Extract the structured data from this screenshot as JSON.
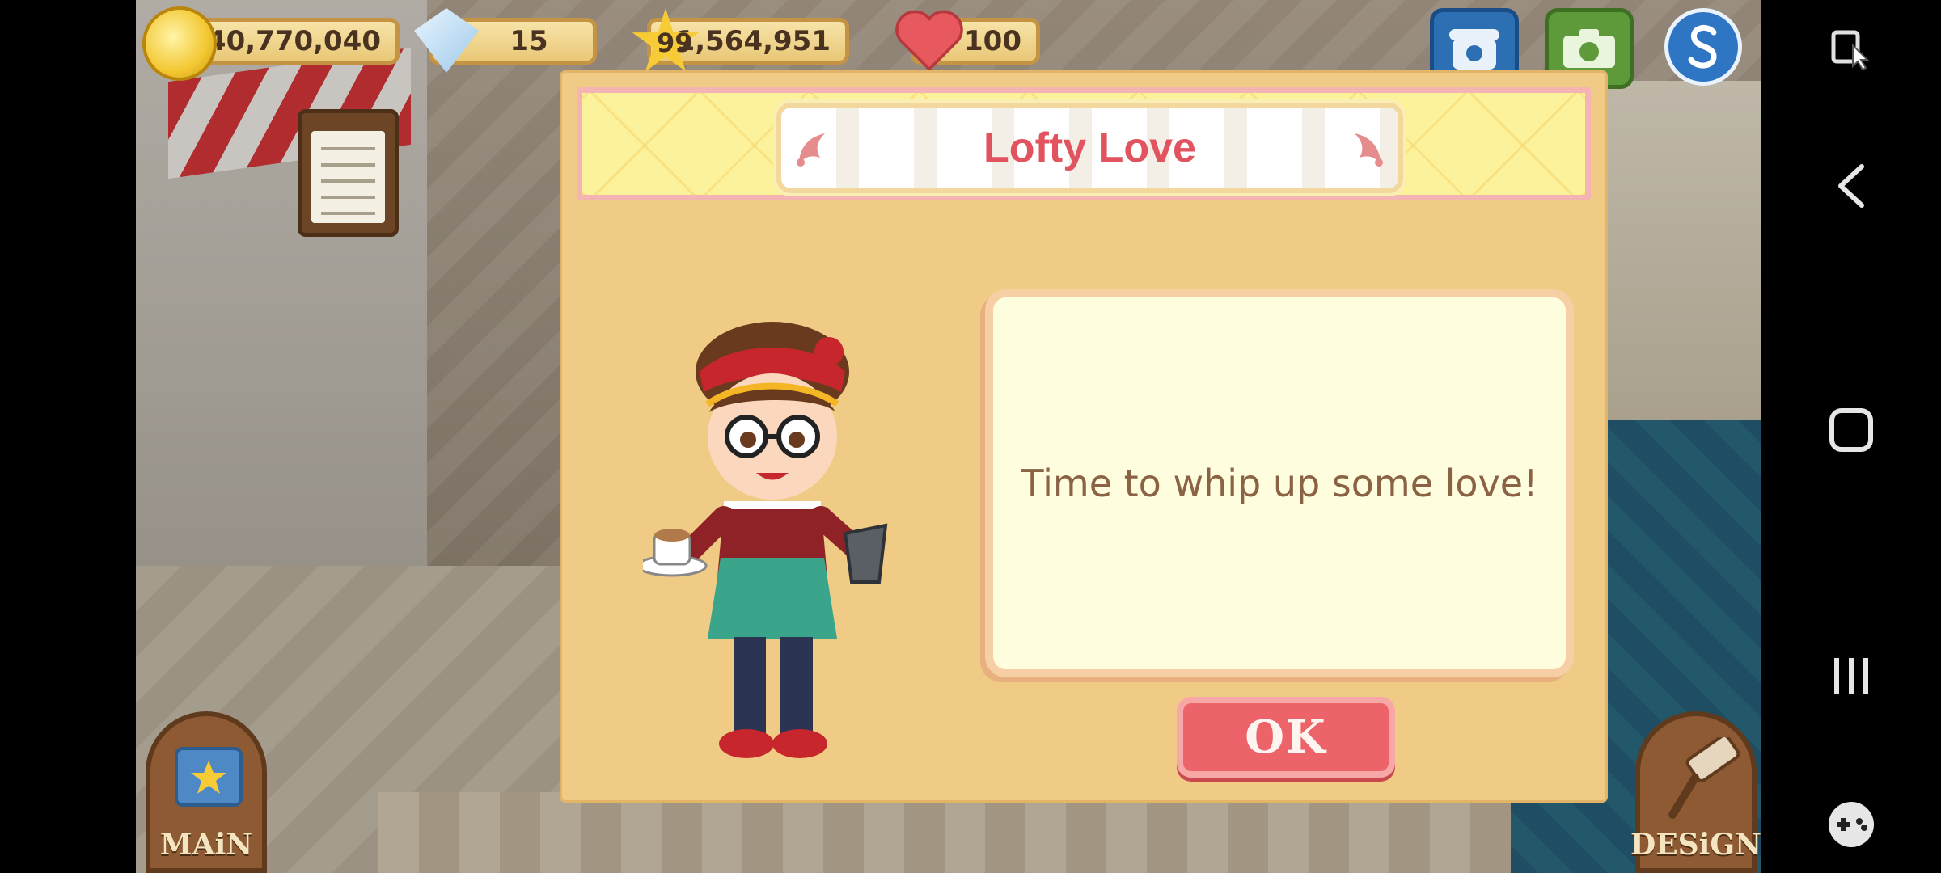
{
  "hud": {
    "coins": "40,770,040",
    "gems": "15",
    "level": "99",
    "xp": "1,564,951",
    "hearts": "100"
  },
  "icons": {
    "coin": "coin-icon",
    "gem": "gem-icon",
    "star": "star-icon",
    "heart": "heart-icon",
    "phone": "phone-icon",
    "camera": "camera-icon",
    "social": "social-icon",
    "clipboard": "clipboard-icon",
    "recipe_book": "recipe-book-icon",
    "paint_roller": "paint-roller-icon"
  },
  "bottom_buttons": {
    "main_label": "MAiN",
    "design_label": "DESiGN"
  },
  "dialog": {
    "title": "Lofty Love",
    "message": "Time to whip up some love!",
    "ok_label": "OK"
  },
  "colors": {
    "dialog_bg": "#f0cb85",
    "title": "#e0535f",
    "ok_button": "#ec6469",
    "message_text": "#8b6244"
  }
}
